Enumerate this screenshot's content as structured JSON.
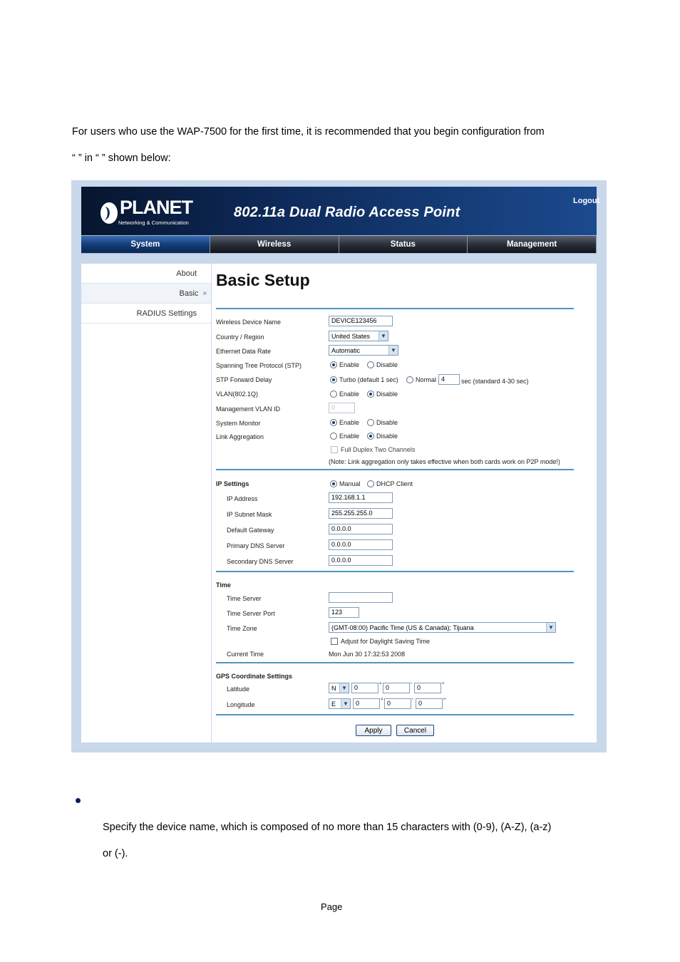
{
  "doc": {
    "intro_line1": "For users who use the WAP-7500 for the first time, it is recommended that you begin configuration from",
    "intro_line2": "“        ” in “           ” shown below:",
    "bullet_para_line1": "Specify the device name, which is composed of no more than 15 characters with (0-9), (A-Z), (a-z)",
    "bullet_para_line2": "or (-).",
    "footer": "Page"
  },
  "app": {
    "brand": "PLANET",
    "brand_sub": "Networking & Communication",
    "product_title": "802.11a Dual Radio Access Point",
    "logout": "Logout",
    "brand_color": "#0d2856",
    "accent_color": "#4f93c2"
  },
  "nav": {
    "tabs": [
      "System",
      "Wireless",
      "Status",
      "Management"
    ],
    "active": "System"
  },
  "sidebar": {
    "items": [
      "About",
      "Basic",
      "RADIUS Settings"
    ],
    "active": "Basic",
    "active_marker": "»"
  },
  "form": {
    "title": "Basic Setup",
    "device_name": {
      "label": "Wireless Device Name",
      "value": "DEVICE123456"
    },
    "country": {
      "label": "Country / Region",
      "value": "United States"
    },
    "ethernet_rate": {
      "label": "Ethernet Data Rate",
      "value": "Automatic"
    },
    "stp": {
      "label": "Spanning Tree Protocol (STP)",
      "options": [
        "Enable",
        "Disable"
      ],
      "selected": "Enable"
    },
    "stp_delay": {
      "label": "STP Forward Delay",
      "turbo": "Turbo (default 1 sec)",
      "normal": "Normal",
      "value": "4",
      "hint": "sec (standard 4-30 sec)",
      "selected": "Turbo"
    },
    "vlan": {
      "label": "VLAN(802.1Q)",
      "options": [
        "Enable",
        "Disable"
      ],
      "selected": "Disable"
    },
    "mgmt_vlan": {
      "label": "Management VLAN ID",
      "value": "0"
    },
    "system_monitor": {
      "label": "System Monitor",
      "options": [
        "Enable",
        "Disable"
      ],
      "selected": "Enable"
    },
    "link_aggregation": {
      "label": "Link Aggregation",
      "options": [
        "Enable",
        "Disable"
      ],
      "selected": "Disable"
    },
    "full_duplex": {
      "label": "Full Duplex Two Channels",
      "checked": false
    },
    "note": "(Note: Link aggregation only takes effective when both cards work on P2P mode!)",
    "ip": {
      "header": "IP Settings",
      "mode_options": [
        "Manual",
        "DHCP Client"
      ],
      "mode_selected": "Manual",
      "address": {
        "label": "IP Address",
        "value": "192.168.1.1"
      },
      "subnet": {
        "label": "IP Subnet Mask",
        "value": "255.255.255.0"
      },
      "gateway": {
        "label": "Default Gateway",
        "value": "0.0.0.0"
      },
      "dns1": {
        "label": "Primary DNS Server",
        "value": "0.0.0.0"
      },
      "dns2": {
        "label": "Secondary DNS Server",
        "value": "0.0.0.0"
      }
    },
    "time": {
      "header": "Time",
      "server": {
        "label": "Time Server",
        "value": ""
      },
      "port": {
        "label": "Time Server Port",
        "value": "123"
      },
      "zone": {
        "label": "Time Zone",
        "value": "(GMT-08:00) Pacific Time (US & Canada); Tijuana"
      },
      "dst": {
        "label": "Adjust for Daylight Saving Time",
        "checked": false
      },
      "current": {
        "label": "Current Time",
        "value": "Mon Jun 30 17:32:53 2008"
      }
    },
    "gps": {
      "header": "GPS Coordinate Settings",
      "latitude": {
        "label": "Latitude",
        "dir": "N",
        "deg": "0",
        "min": "0",
        "sec": "0"
      },
      "longitude": {
        "label": "Longitude",
        "dir": "E",
        "deg": "0",
        "min": "0",
        "sec": "0"
      },
      "deg_symbol": "°",
      "min_symbol": "'",
      "sec_symbol": "\""
    },
    "apply": "Apply",
    "cancel": "Cancel"
  }
}
